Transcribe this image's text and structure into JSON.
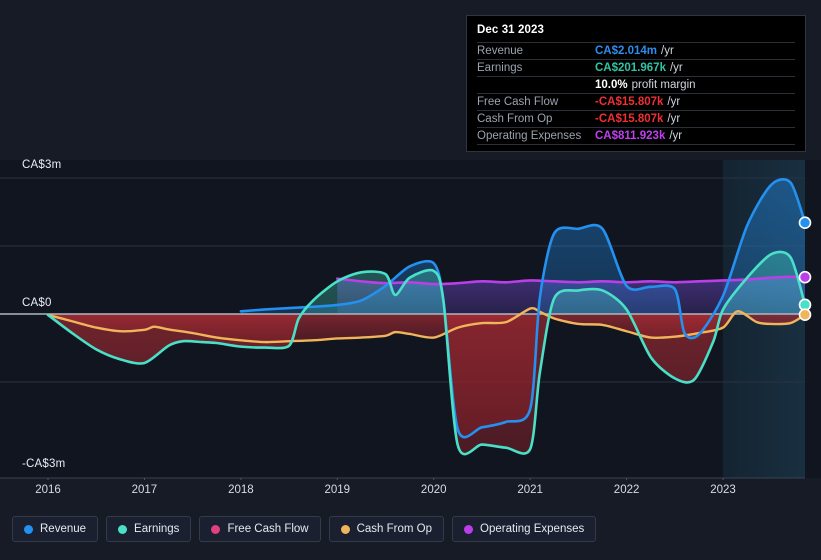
{
  "tooltip": {
    "date": "Dec 31 2023",
    "rows": [
      {
        "label": "Revenue",
        "value": "CA$2.014m",
        "unit": "/yr",
        "color": "#2d8cf0"
      },
      {
        "label": "Earnings",
        "value": "CA$201.967k",
        "unit": "/yr",
        "color": "#2ec4a6"
      },
      {
        "label": "",
        "value": "10.0%",
        "unit": "profit margin",
        "color": "#ffffff"
      },
      {
        "label": "Free Cash Flow",
        "value": "-CA$15.807k",
        "unit": "/yr",
        "color": "#f03030"
      },
      {
        "label": "Cash From Op",
        "value": "-CA$15.807k",
        "unit": "/yr",
        "color": "#f03030"
      },
      {
        "label": "Operating Expenses",
        "value": "CA$811.923k",
        "unit": "/yr",
        "color": "#c13ff0"
      }
    ]
  },
  "axis": {
    "y_top": "CA$3m",
    "y_zero": "CA$0",
    "y_bottom": "-CA$3m",
    "x_ticks": [
      "2016",
      "2017",
      "2018",
      "2019",
      "2020",
      "2021",
      "2022",
      "2023"
    ]
  },
  "legend": {
    "items": [
      {
        "label": "Revenue",
        "color": "#2490ef"
      },
      {
        "label": "Earnings",
        "color": "#4ae0c8"
      },
      {
        "label": "Free Cash Flow",
        "color": "#e0407f"
      },
      {
        "label": "Cash From Op",
        "color": "#f0b45a"
      },
      {
        "label": "Operating Expenses",
        "color": "#bb3fe8"
      }
    ]
  },
  "chart_data": {
    "type": "area",
    "title": "",
    "xlabel": "",
    "ylabel": "",
    "ylim": [
      -3,
      3
    ],
    "xlim": [
      2016,
      2023.85
    ],
    "y_ticks": [
      3,
      0,
      -3
    ],
    "gridlines": [
      3,
      1.5,
      -1.5
    ],
    "grid": true,
    "zero_line": true,
    "currency": "CA$",
    "units": "millions",
    "legend_position": "bottom",
    "forecast_start": 2023.0,
    "series": [
      {
        "name": "Revenue",
        "color": "#2490ef",
        "fill": "rgba(36,144,239,0.26)",
        "x": [
          2018.0,
          2018.25,
          2018.5,
          2018.75,
          2019.0,
          2019.25,
          2019.5,
          2019.75,
          2020.0,
          2020.1,
          2020.25,
          2020.5,
          2020.75,
          2021.0,
          2021.1,
          2021.25,
          2021.5,
          2021.75,
          2022.0,
          2022.25,
          2022.5,
          2022.6,
          2022.75,
          2023.0,
          2023.25,
          2023.5,
          2023.7,
          2023.85
        ],
        "y": [
          0.06,
          0.1,
          0.13,
          0.16,
          0.2,
          0.3,
          0.62,
          1.05,
          1.12,
          0.3,
          -2.55,
          -2.5,
          -2.38,
          -2.1,
          0.35,
          1.78,
          1.88,
          1.88,
          0.62,
          0.6,
          0.55,
          -0.42,
          -0.45,
          0.4,
          1.95,
          2.85,
          2.9,
          2.014
        ]
      },
      {
        "name": "Earnings",
        "color": "#4ae0c8",
        "fill": "rgba(74,224,200,0.24)",
        "x": [
          2016.0,
          2016.25,
          2016.5,
          2016.75,
          2017.0,
          2017.25,
          2017.4,
          2017.6,
          2017.75,
          2018.0,
          2018.25,
          2018.5,
          2018.6,
          2018.75,
          2019.0,
          2019.25,
          2019.5,
          2019.6,
          2019.75,
          2020.0,
          2020.1,
          2020.25,
          2020.5,
          2020.75,
          2021.0,
          2021.1,
          2021.25,
          2021.5,
          2021.75,
          2022.0,
          2022.25,
          2022.5,
          2022.7,
          2022.9,
          2023.0,
          2023.25,
          2023.5,
          2023.7,
          2023.85
        ],
        "y": [
          -0.02,
          -0.42,
          -0.78,
          -1.0,
          -1.08,
          -0.7,
          -0.6,
          -0.62,
          -0.64,
          -0.72,
          -0.74,
          -0.7,
          -0.1,
          0.3,
          0.72,
          0.92,
          0.88,
          0.42,
          0.8,
          0.95,
          0.3,
          -2.9,
          -2.88,
          -2.95,
          -2.98,
          -1.3,
          0.35,
          0.52,
          0.52,
          0.1,
          -0.95,
          -1.42,
          -1.45,
          -0.6,
          0.1,
          0.8,
          1.32,
          1.25,
          0.202
        ]
      },
      {
        "name": "Free Cash Flow",
        "color": "#e0407f",
        "fill": "rgba(224,64,127,0.0)",
        "x": [],
        "y": []
      },
      {
        "name": "Cash From Op",
        "color": "#f0b45a",
        "fill": "rgba(240,180,90,0.0)",
        "x": [
          2016.0,
          2016.25,
          2016.5,
          2016.75,
          2017.0,
          2017.1,
          2017.25,
          2017.5,
          2017.75,
          2018.0,
          2018.25,
          2018.5,
          2018.75,
          2019.0,
          2019.25,
          2019.5,
          2019.6,
          2019.75,
          2020.0,
          2020.25,
          2020.5,
          2020.75,
          2021.0,
          2021.1,
          2021.25,
          2021.5,
          2021.75,
          2022.0,
          2022.25,
          2022.5,
          2022.75,
          2023.0,
          2023.15,
          2023.35,
          2023.5,
          2023.7,
          2023.85
        ],
        "y": [
          -0.02,
          -0.16,
          -0.3,
          -0.38,
          -0.35,
          -0.28,
          -0.34,
          -0.42,
          -0.52,
          -0.58,
          -0.62,
          -0.6,
          -0.58,
          -0.54,
          -0.52,
          -0.48,
          -0.4,
          -0.44,
          -0.52,
          -0.3,
          -0.2,
          -0.18,
          0.12,
          0.05,
          -0.1,
          -0.22,
          -0.24,
          -0.38,
          -0.52,
          -0.5,
          -0.42,
          -0.3,
          0.06,
          -0.18,
          -0.22,
          -0.2,
          -0.016
        ]
      },
      {
        "name": "Operating Expenses",
        "color": "#bb3fe8",
        "fill": "rgba(150,70,230,0.28)",
        "x": [
          2019.0,
          2019.25,
          2019.5,
          2019.75,
          2020.0,
          2020.25,
          2020.5,
          2020.75,
          2021.0,
          2021.25,
          2021.5,
          2021.75,
          2022.0,
          2022.25,
          2022.5,
          2022.75,
          2023.0,
          2023.25,
          2023.5,
          2023.7,
          2023.85
        ],
        "y": [
          0.78,
          0.72,
          0.68,
          0.7,
          0.66,
          0.68,
          0.72,
          0.7,
          0.74,
          0.72,
          0.7,
          0.72,
          0.7,
          0.72,
          0.7,
          0.72,
          0.74,
          0.76,
          0.8,
          0.82,
          0.812
        ]
      }
    ],
    "endpoints": [
      {
        "name": "Revenue",
        "value": 2.014,
        "color": "#2490ef"
      },
      {
        "name": "Operating Expenses",
        "value": 0.812,
        "color": "#bb3fe8"
      },
      {
        "name": "Earnings",
        "value": 0.202,
        "color": "#4ae0c8"
      },
      {
        "name": "Cash From Op",
        "value": -0.016,
        "color": "#f0b45a"
      }
    ]
  }
}
